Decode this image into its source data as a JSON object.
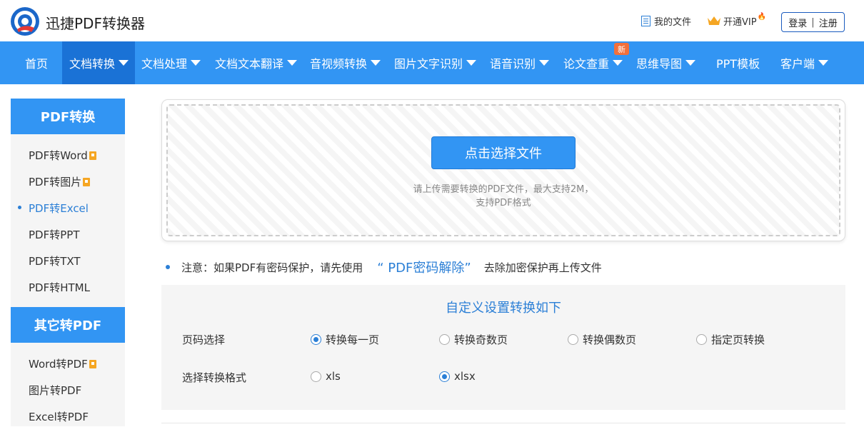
{
  "header": {
    "brand": "迅捷PDF转换器",
    "my_files": "我的文件",
    "vip": "开通VIP",
    "login": "登录",
    "register": "注册"
  },
  "nav": {
    "items": [
      {
        "label": "首页"
      },
      {
        "label": "文档转换"
      },
      {
        "label": "文档处理"
      },
      {
        "label": "文档文本翻译"
      },
      {
        "label": "音视频转换"
      },
      {
        "label": "图片文字识别"
      },
      {
        "label": "语音识别"
      },
      {
        "label": "论文查重"
      },
      {
        "label": "思维导图"
      },
      {
        "label": "PPT模板"
      },
      {
        "label": "客户端"
      }
    ],
    "new_badge": "新",
    "active": "文档转换"
  },
  "sidebar": {
    "sections": [
      {
        "title": "PDF转换",
        "items": [
          {
            "label": "PDF转Word"
          },
          {
            "label": "PDF转图片"
          },
          {
            "label": "PDF转Excel"
          },
          {
            "label": "PDF转PPT"
          },
          {
            "label": "PDF转TXT"
          },
          {
            "label": "PDF转HTML"
          }
        ]
      },
      {
        "title": "其它转PDF",
        "items": [
          {
            "label": "Word转PDF"
          },
          {
            "label": "图片转PDF"
          },
          {
            "label": "Excel转PDF"
          }
        ]
      }
    ],
    "active_item": "PDF转Excel"
  },
  "upload": {
    "button": "点击选择文件",
    "hint_line1": "请上传需要转换的PDF文件，最大支持2M，",
    "hint_line2": "支持PDF格式"
  },
  "notice": {
    "prefix": "注意：如果PDF有密码保护，请先使用",
    "link": "“ PDF密码解除”",
    "suffix": "去除加密保护再上传文件"
  },
  "settings": {
    "title": "自定义设置转换如下",
    "page_label": "页码选择",
    "page_options": [
      {
        "label": "转换每一页",
        "checked": true
      },
      {
        "label": "转换奇数页",
        "checked": false
      },
      {
        "label": "转换偶数页",
        "checked": false
      },
      {
        "label": "指定页转换",
        "checked": false
      }
    ],
    "format_label": "选择转换格式",
    "format_options": [
      {
        "label": "xls",
        "checked": false
      },
      {
        "label": "xlsx",
        "checked": true
      }
    ]
  },
  "colors": {
    "nav_bg": "#3295f3",
    "nav_active": "#1a72d6",
    "accent": "#2b7fd6",
    "badge": "#f2703b"
  }
}
